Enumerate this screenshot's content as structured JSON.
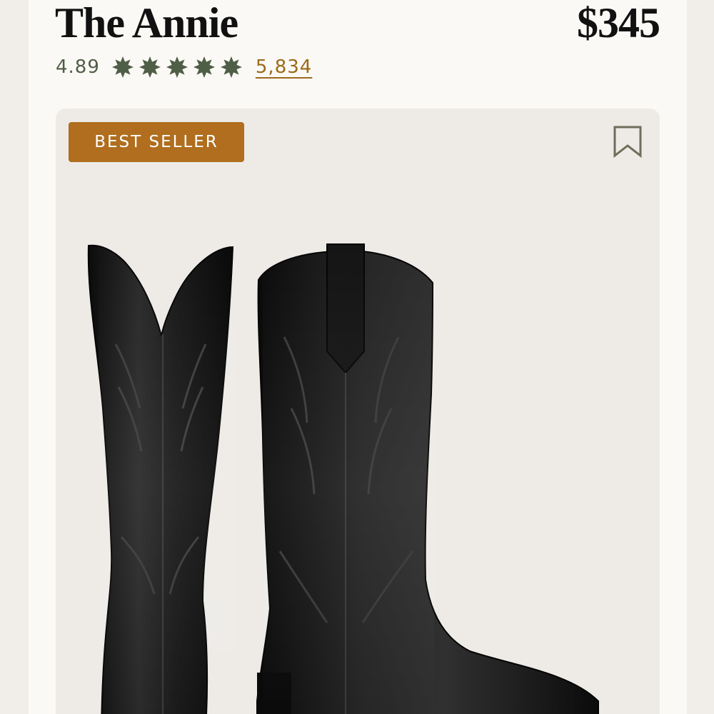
{
  "product": {
    "title": "The Annie",
    "price": "$345",
    "rating": "4.89",
    "star_count": 5,
    "star_icon": "star-burst-icon",
    "review_count": "5,834",
    "badge": "BEST SELLER",
    "bookmark_icon": "bookmark-icon"
  },
  "colors": {
    "background": "#fbf9f5",
    "image_background": "#eeebe7",
    "star": "#4f5e46",
    "review_link": "#9b6a1a",
    "badge": "#b06e1e",
    "text": "#111111"
  }
}
